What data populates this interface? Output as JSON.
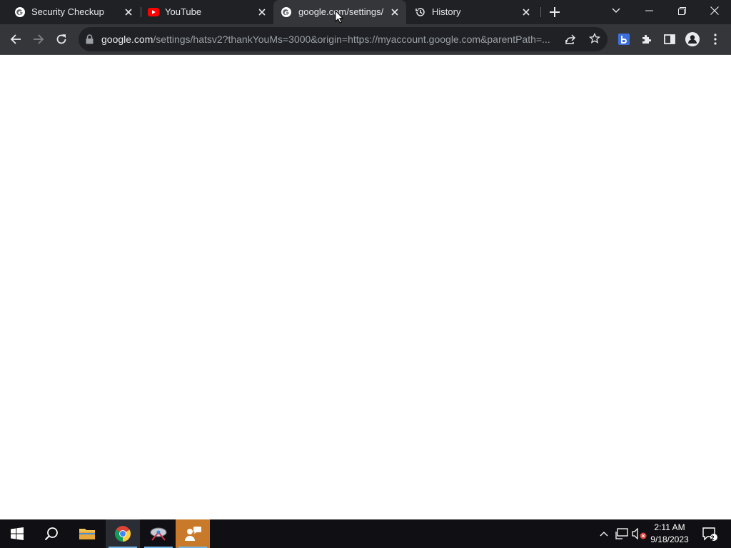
{
  "tabs": [
    {
      "title": "Security Checkup",
      "favicon": "google-g-icon"
    },
    {
      "title": "YouTube",
      "favicon": "youtube-icon"
    },
    {
      "title": "google.com/settings/h",
      "favicon": "google-g-icon",
      "active": true
    },
    {
      "title": "History",
      "favicon": "history-icon"
    }
  ],
  "address_bar": {
    "host": "google.com",
    "path": "/settings/hatsv2?thankYouMs=3000&origin=https://myaccount.google.com&parentPath=..."
  },
  "clock": {
    "time": "2:11 AM",
    "date": "9/18/2023"
  },
  "notification_count": "2",
  "colors": {
    "tabstrip": "#202124",
    "toolbar": "#35363a",
    "taskbar": "#101014",
    "page": "#ffffff"
  }
}
